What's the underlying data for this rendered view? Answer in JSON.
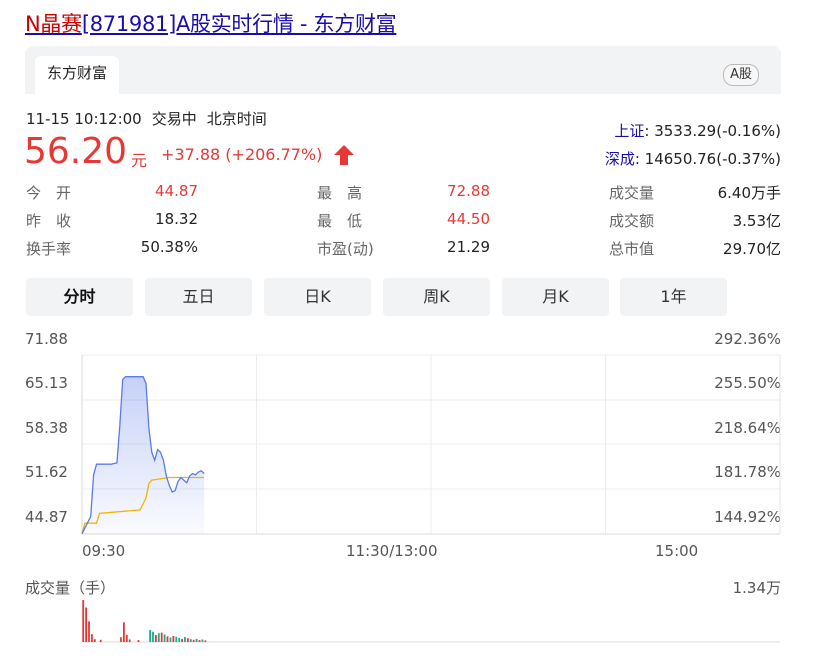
{
  "title": {
    "highlight": "N晶赛",
    "rest": "[871981]A股实时行情 - 东方财富"
  },
  "source_tab": {
    "label": "东方财富",
    "badge": "A股"
  },
  "status": {
    "datetime": "11-15 10:12:00",
    "state": "交易中",
    "tz": "北京时间"
  },
  "quote": {
    "price": "56.20",
    "unit": "元",
    "change": "+37.88 (+206.77%)"
  },
  "indices": [
    {
      "name": "上证",
      "value": ": 3533.29(-0.16%)"
    },
    {
      "name": "深成",
      "value": ": 14650.76(-0.37%)"
    }
  ],
  "stats": [
    {
      "label": "今　开",
      "value": "44.87"
    },
    {
      "label": "最　高",
      "value": "72.88"
    },
    {
      "label": "成交量",
      "value": "6.40万手"
    },
    {
      "label": "昨　收",
      "value": "18.32"
    },
    {
      "label": "最　低",
      "value": "44.50"
    },
    {
      "label": "成交额",
      "value": "3.53亿"
    },
    {
      "label": "换手率",
      "value": "50.38%"
    },
    {
      "label": "市盈(动)",
      "value": "21.29"
    },
    {
      "label": "总市值",
      "value": "29.70亿"
    }
  ],
  "period_tabs": [
    "分时",
    "五日",
    "日K",
    "周K",
    "月K",
    "1年"
  ],
  "colors": {
    "rise": "#e53935",
    "fall": "#1aaa88",
    "price_line": "#5b7be9",
    "avg_line": "#f0b400",
    "link": "#1a0dab"
  },
  "icons": {
    "change_arrow": "up-arrow-icon"
  },
  "chart_data": {
    "type": "line",
    "y_left_ticks": [
      "71.88",
      "65.13",
      "58.38",
      "51.62",
      "44.87"
    ],
    "y_right_ticks": [
      "292.36%",
      "255.50%",
      "218.64%",
      "181.78%",
      "144.92%"
    ],
    "x_ticks": [
      "09:30",
      "11:30/13:00",
      "15:00"
    ],
    "ylim": [
      44.87,
      71.88
    ],
    "minutes_total": 240,
    "series": [
      {
        "x": [
          0,
          3,
          4,
          5,
          10,
          12,
          13,
          14,
          15,
          16,
          21,
          22,
          23,
          24,
          25,
          26,
          27,
          28,
          29,
          30,
          31,
          32,
          33,
          34,
          35,
          36,
          37,
          38,
          39,
          40,
          41,
          42
        ],
        "values": [
          44.9,
          47.5,
          53.8,
          55.4,
          55.4,
          55.6,
          61.2,
          68.2,
          68.6,
          68.6,
          68.6,
          67.6,
          60.8,
          57.2,
          56.0,
          57.6,
          57.2,
          56.0,
          53.6,
          52.2,
          51.2,
          51.4,
          52.8,
          53.4,
          53.0,
          52.6,
          53.6,
          54.0,
          53.8,
          54.2,
          54.4,
          54.0
        ]
      },
      {
        "x": [
          0,
          1,
          5,
          6,
          20,
          22,
          23,
          24,
          30,
          42
        ],
        "values": [
          44.9,
          46.5,
          46.5,
          48.0,
          48.5,
          50.3,
          52.5,
          53.0,
          53.4,
          53.4
        ]
      }
    ]
  },
  "volume": {
    "label": "成交量（手）",
    "max_label": "1.34万",
    "max": 13400,
    "bars": [
      {
        "m": 0,
        "v": 13400,
        "d": "up"
      },
      {
        "m": 1,
        "v": 11000,
        "d": "up"
      },
      {
        "m": 2,
        "v": 6600,
        "d": "up"
      },
      {
        "m": 3,
        "v": 2500,
        "d": "up"
      },
      {
        "m": 4,
        "v": 900,
        "d": "up"
      },
      {
        "m": 6,
        "v": 700,
        "d": "up"
      },
      {
        "m": 13,
        "v": 1500,
        "d": "up"
      },
      {
        "m": 14,
        "v": 6300,
        "d": "up"
      },
      {
        "m": 15,
        "v": 2300,
        "d": "up"
      },
      {
        "m": 16,
        "v": 800,
        "d": "up"
      },
      {
        "m": 19,
        "v": 600,
        "d": "up"
      },
      {
        "m": 23,
        "v": 3800,
        "d": "down"
      },
      {
        "m": 24,
        "v": 3300,
        "d": "down"
      },
      {
        "m": 25,
        "v": 2200,
        "d": "up"
      },
      {
        "m": 26,
        "v": 2800,
        "d": "down"
      },
      {
        "m": 27,
        "v": 3000,
        "d": "up"
      },
      {
        "m": 28,
        "v": 2400,
        "d": "down"
      },
      {
        "m": 29,
        "v": 1800,
        "d": "up"
      },
      {
        "m": 30,
        "v": 1400,
        "d": "down"
      },
      {
        "m": 31,
        "v": 1900,
        "d": "up"
      },
      {
        "m": 32,
        "v": 1700,
        "d": "down"
      },
      {
        "m": 33,
        "v": 1300,
        "d": "down"
      },
      {
        "m": 34,
        "v": 1000,
        "d": "up"
      },
      {
        "m": 35,
        "v": 1600,
        "d": "down"
      },
      {
        "m": 36,
        "v": 1200,
        "d": "up"
      },
      {
        "m": 37,
        "v": 900,
        "d": "down"
      },
      {
        "m": 38,
        "v": 700,
        "d": "up"
      },
      {
        "m": 39,
        "v": 1000,
        "d": "down"
      },
      {
        "m": 40,
        "v": 600,
        "d": "up"
      },
      {
        "m": 41,
        "v": 800,
        "d": "down"
      },
      {
        "m": 42,
        "v": 500,
        "d": "up"
      }
    ]
  }
}
